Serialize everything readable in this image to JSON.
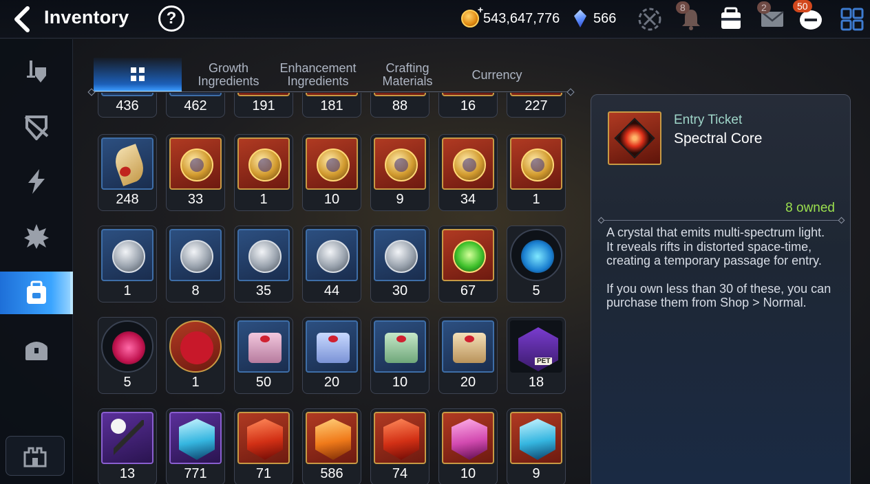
{
  "header": {
    "title": "Inventory",
    "help_label": "?",
    "gold": "543,647,776",
    "crystals": "566",
    "plus_label": "+",
    "notifications_badge": "8",
    "mail_badge": "2",
    "chat_badge": "50"
  },
  "tabs": [
    {
      "label": "",
      "icon": "grid-icon",
      "active": true
    },
    {
      "label": "Growth\nIngredients"
    },
    {
      "label": "Enhancement\nIngredients"
    },
    {
      "label": "Crafting\nMaterials"
    },
    {
      "label": "Currency"
    }
  ],
  "sidebar": {
    "items": [
      {
        "icon": "sword-shield-icon"
      },
      {
        "icon": "broken-shield-icon"
      },
      {
        "icon": "lightning-icon"
      },
      {
        "icon": "spiky-fist-icon"
      },
      {
        "icon": "backpack-icon",
        "active": true
      },
      {
        "icon": "chest-icon"
      }
    ],
    "bottom_icon": "castle-icon"
  },
  "grid": {
    "rows": [
      [
        "436",
        "462",
        "191",
        "181",
        "88",
        "16",
        "227"
      ],
      [
        "248",
        "33",
        "1",
        "10",
        "9",
        "34",
        "1"
      ],
      [
        "1",
        "8",
        "35",
        "44",
        "30",
        "67",
        "5"
      ],
      [
        "5",
        "1",
        "50",
        "20",
        "10",
        "20",
        "18"
      ],
      [
        "13",
        "771",
        "71",
        "586",
        "74",
        "10",
        "9"
      ]
    ]
  },
  "detail": {
    "category": "Entry Ticket",
    "name": "Spectral Core",
    "owned": "8 owned",
    "description_1": "A crystal that emits multi-spectrum light.",
    "description_2": "It reveals rifts in distorted space-time, creating a temporary passage for entry.",
    "description_3": "If you own less than 30 of these, you can purchase them from Shop > Normal."
  },
  "colors": {
    "accent": "#3aa4ff",
    "owned_green": "#9be04e",
    "category_teal": "#9fd6c9"
  }
}
